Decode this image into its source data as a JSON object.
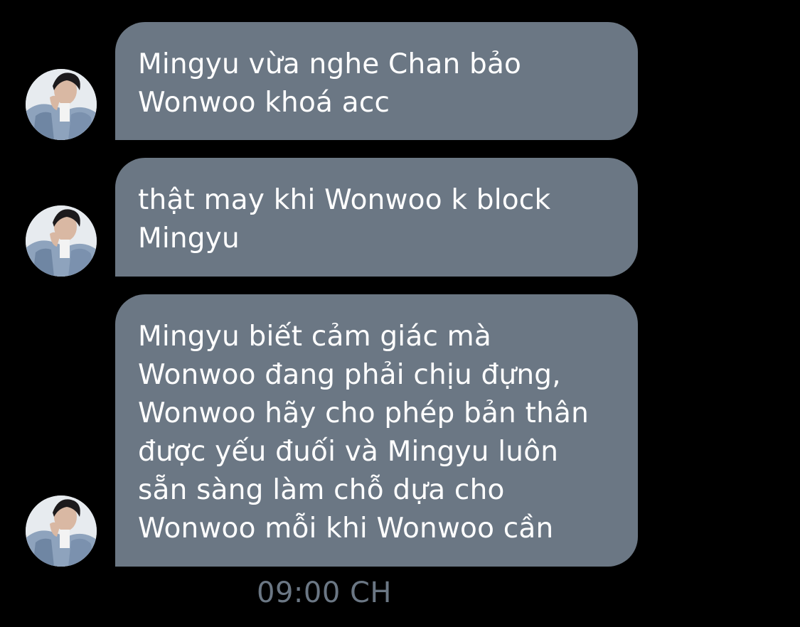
{
  "messages": [
    {
      "lines": [
        "Mingyu vừa nghe Chan bảo",
        "Wonwoo khoá acc"
      ]
    },
    {
      "lines": [
        "thật may khi Wonwoo k block",
        "Mingyu"
      ]
    },
    {
      "lines": [
        "Mingyu biết cảm giác mà",
        "Wonwoo đang phải chịu đựng,",
        "Wonwoo hãy cho phép bản thân",
        "được yếu đuối và Mingyu luôn",
        "sẵn sàng làm chỗ dựa cho",
        "Wonwoo mỗi khi Wonwoo cần"
      ]
    }
  ],
  "timestamp": "09:00 CH",
  "colors": {
    "background": "#000000",
    "bubble": "#6b7784",
    "bubble_text": "#ffffff",
    "timestamp": "#6b7784"
  },
  "icons": {
    "avatar": "avatar-photo"
  }
}
